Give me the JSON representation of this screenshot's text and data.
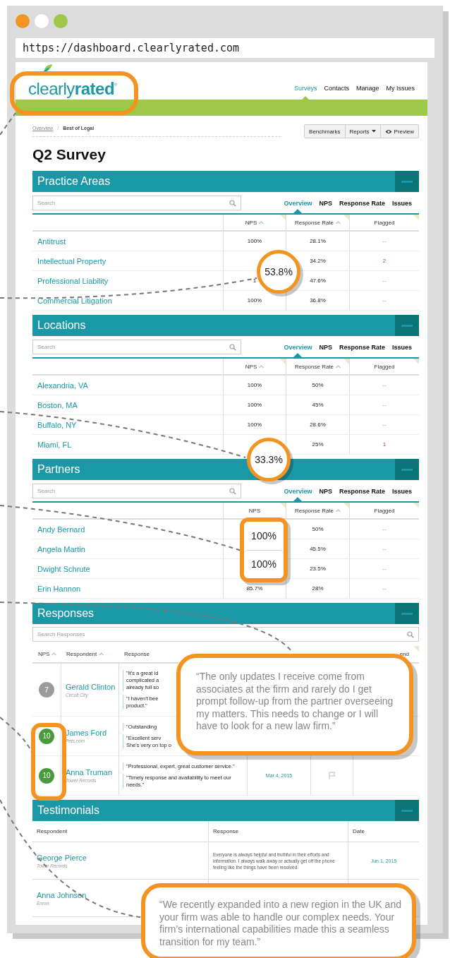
{
  "browser": {
    "url": "https://dashboard.clearlyrated.com"
  },
  "header": {
    "logo": "clearly**rated**$^{®}$",
    "nav": [
      {
        "label": "Surveys",
        "selected": true
      },
      {
        "label": "Contacts",
        "selected": false
      },
      {
        "label": "Manage",
        "selected": false
      },
      {
        "label": "My Issues",
        "selected": false
      }
    ]
  },
  "breadcrumb": {
    "items": [
      {
        "label": "Overview",
        "kind": "link"
      },
      {
        "label": "Best of Legal",
        "kind": "current"
      }
    ],
    "separator": "/"
  },
  "toolbar": [
    {
      "label": "Benchmarks",
      "kind": "plain"
    },
    {
      "label": "Reports",
      "kind": "dropdown"
    },
    {
      "label": "Preview",
      "kind": "eye"
    }
  ],
  "title": "Q2 Survey",
  "sections": [
    {
      "kind": "summary",
      "title": "Practice Areas",
      "search": {
        "placeholder": "Search"
      },
      "tabs": [
        {
          "label": "Overview",
          "selected": true
        },
        {
          "label": "NPS",
          "selected": false
        },
        {
          "label": "Response Rate",
          "selected": false
        },
        {
          "label": "Issues",
          "selected": false
        }
      ],
      "columns": [
        {
          "label": "NPS",
          "sortable": true
        },
        {
          "label": "Response Rate",
          "sortable": true
        },
        {
          "label": "Flagged",
          "sortable": false
        }
      ],
      "rows": [
        {
          "name": "Antitrust",
          "nps": "100%",
          "response_rate": "28.1%",
          "flagged": "--"
        },
        {
          "name": "Intellectual Property",
          "response_rate": "34.2%",
          "flagged": "2"
        },
        {
          "name": "Professional Liability",
          "nps": "1",
          "response_rate": "47.6%",
          "flagged": "--"
        },
        {
          "name": "Commercial Litigation",
          "nps": "100%",
          "response_rate": "36.8%",
          "flagged": "--"
        }
      ]
    },
    {
      "kind": "summary",
      "title": "Locations",
      "search": {
        "placeholder": "Search"
      },
      "tabs": [
        {
          "label": "Overview",
          "selected": true
        },
        {
          "label": "NPS",
          "selected": false
        },
        {
          "label": "Response Rate",
          "selected": false
        },
        {
          "label": "Issues",
          "selected": false
        }
      ],
      "columns": [
        {
          "label": "NPS",
          "sortable": true
        },
        {
          "label": "Response Rate",
          "sortable": true
        },
        {
          "label": "Flagged",
          "sortable": false
        }
      ],
      "rows": [
        {
          "name": "Alexandria, VA",
          "nps": "100%",
          "response_rate": "50%",
          "flagged": "--"
        },
        {
          "name": "Boston, MA",
          "nps": "100%",
          "response_rate": "45%",
          "flagged": "--"
        },
        {
          "name": "Buffalo, NY",
          "nps": "100%",
          "response_rate": "28.6%",
          "flagged": "--"
        },
        {
          "name": "Miami, FL",
          "response_rate": "25%",
          "flagged": "1"
        }
      ]
    },
    {
      "kind": "summary",
      "title": "Partners",
      "search": {
        "placeholder": "Search"
      },
      "tabs": [
        {
          "label": "Overview",
          "selected": true
        },
        {
          "label": "NPS",
          "selected": false
        },
        {
          "label": "Response Rate",
          "selected": false
        },
        {
          "label": "Issues",
          "selected": false
        }
      ],
      "columns": [
        {
          "label": "NPS",
          "sortable": false
        },
        {
          "label": "Response Rate",
          "sortable": true
        },
        {
          "label": "Flagged",
          "sortable": false
        }
      ],
      "rows": [
        {
          "name": "Andy Bernard",
          "response_rate": "50%",
          "flagged": "--"
        },
        {
          "name": "Angela Martin",
          "response_rate": "45.5%",
          "flagged": "--"
        },
        {
          "name": "Dwight Schrute",
          "response_rate": "23.5%",
          "flagged": "--"
        },
        {
          "name": "Erin Hannon",
          "nps": "85.7%",
          "response_rate": "28%",
          "flagged": "--"
        }
      ]
    },
    {
      "kind": "responses",
      "title": "Responses",
      "search": {
        "placeholder": "Search Responses"
      },
      "columns": [
        {
          "label": "NPS",
          "sortable": true
        },
        {
          "label": "Respondent",
          "sortable": true
        },
        {
          "label": "Response",
          "sortable": false
        },
        {
          "label": "end",
          "sortable": false
        }
      ],
      "rows": [
        {
          "score": "7",
          "color": "#9b9b9b",
          "respondent": "Gerald Clinton",
          "company": "Circuit City",
          "responses": [
            [
              "\"It's a great id",
              "complicated a",
              "already full so"
            ],
            [
              "\"I haven't bee",
              "product.\""
            ]
          ]
        },
        {
          "score": "10",
          "color": "#4a9a3d",
          "respondent": "James Ford",
          "company": "Pets.com",
          "responses": [
            [
              "\"Outstanding"
            ],
            [
              "\"Excellent serv",
              "She's very on top o"
            ]
          ]
        },
        {
          "score": "10",
          "color": "#4a9a3d",
          "respondent": "Anna Truman",
          "company": "Tower Records",
          "responses": [
            [
              "\"Professional, expert, great customer service.\""
            ],
            [
              "\"Timely response and availability to meet our",
              "needs.\""
            ]
          ],
          "date": "Mar 4, 2015",
          "flagged": false
        }
      ]
    },
    {
      "kind": "testimonials",
      "title": "Testimonials",
      "columns": [
        {
          "label": "Respondent"
        },
        {
          "label": "Response"
        },
        {
          "label": "Date"
        }
      ],
      "rows": [
        {
          "respondent": "George Pierce",
          "company": "Tower Records",
          "response": "Everyone is always helpful and truthful in their efforts and information. I always walk away or actually get off the phone feeling like the things have been resolved.",
          "date": "Jun 1, 2015"
        },
        {
          "respondent": "Anna Johnson",
          "company": "Enron"
        }
      ]
    }
  ],
  "callouts": [
    {
      "kind": "ring"
    },
    {
      "kind": "circle",
      "text": "53.8%"
    },
    {
      "kind": "circle",
      "text": "33.3%"
    },
    {
      "kind": "stack",
      "texts": [
        "100%",
        "100%"
      ]
    },
    {
      "kind": "ring"
    },
    {
      "kind": "quote",
      "text": "“The only updates I receive come from associates at the firm and rarely do I get prompt follow-up from the partner overseeing my matters. This needs to change or I will have to look for a new law firm.”"
    },
    {
      "kind": "quote",
      "text": "“We recently expanded into a new region in the UK and your firm was able to handle our complex needs. Your firm’s international capabilities made this a seamless transition for my team.”"
    }
  ]
}
